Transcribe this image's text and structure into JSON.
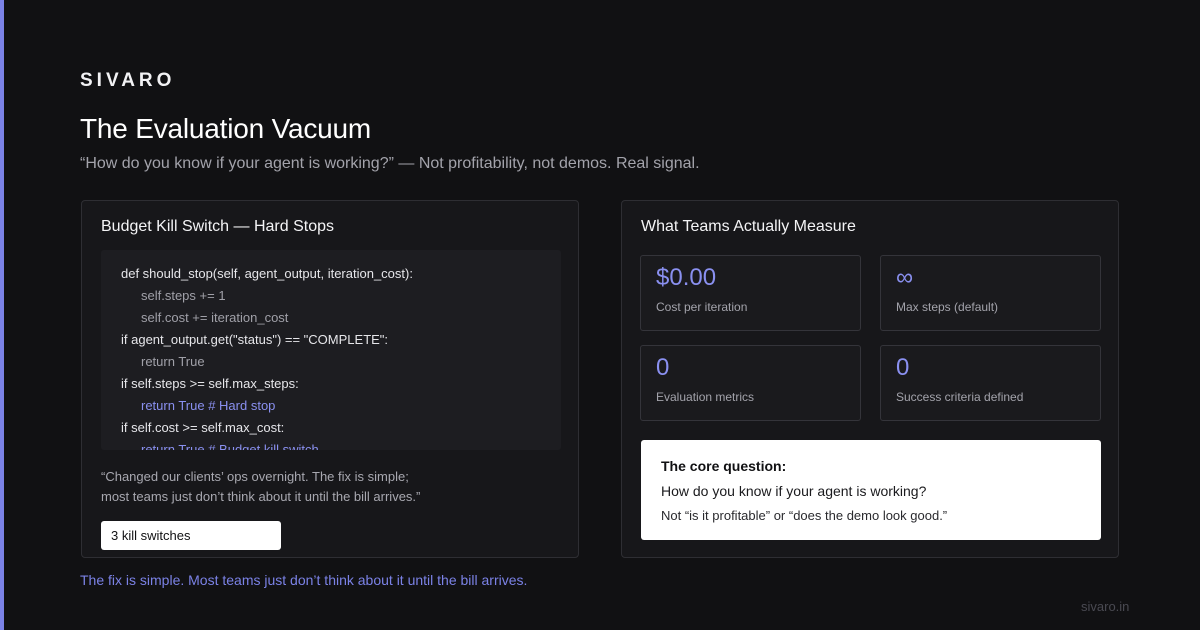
{
  "brand": "SIVARO",
  "title": "The Evaluation Vacuum",
  "subtitle": "“How do you know if your agent is working?” — Not profitability, not demos. Real signal.",
  "left_card": {
    "title": "Budget Kill Switch — Hard Stops",
    "code": [
      "def should_stop(self, agent_output, iteration_cost):",
      "self.steps += 1",
      "self.cost += iteration_cost",
      "if agent_output.get(\"status\") == \"COMPLETE\":",
      "return True",
      "if self.steps >= self.max_steps:",
      "return True # Hard stop",
      "if self.cost >= self.max_cost:",
      "return True # Budget kill switch"
    ],
    "quote_line1": "“Changed our clients’ ops overnight. The fix is simple;",
    "quote_line2": "most teams just don’t think about it until the bill arrives.”",
    "badge": "3 kill switches"
  },
  "right_card": {
    "title": "What Teams Actually Measure",
    "metrics": [
      {
        "value": "$0.00",
        "label": "Cost per iteration"
      },
      {
        "value": "∞",
        "label": "Max steps (default)"
      },
      {
        "value": "0",
        "label": "Evaluation metrics"
      },
      {
        "value": "0",
        "label": "Success criteria defined"
      }
    ],
    "core": {
      "heading": "The core question:",
      "question": "How do you know if your agent is working?",
      "note": "Not “is it profitable” or “does the demo look good.”"
    }
  },
  "footer_note": "The fix is simple. Most teams just don’t think about it until the bill arrives.",
  "site": "sivaro.in",
  "colors": {
    "background": "#111113",
    "accent": "#7b82e6",
    "card": "#17171a",
    "card_border": "#2e2e33"
  }
}
